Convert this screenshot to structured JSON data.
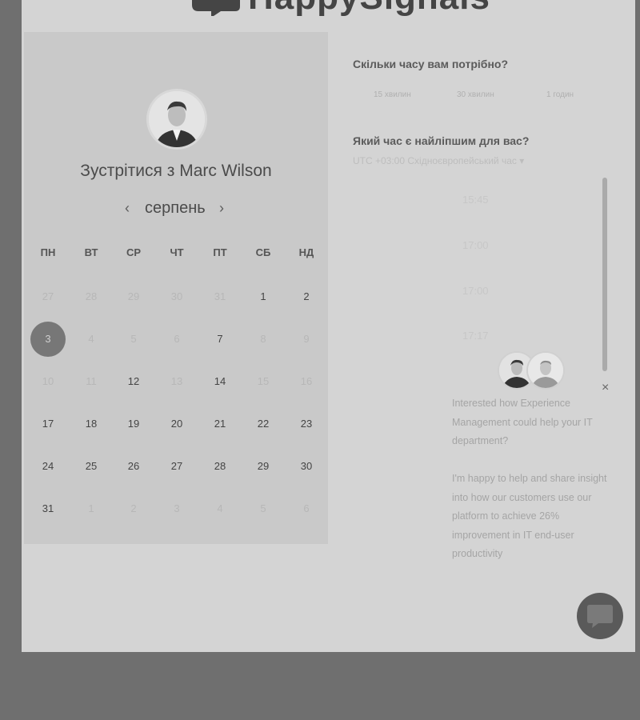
{
  "brand": {
    "name": "HappySignals"
  },
  "calendar": {
    "title": "Зустрітися з Marc Wilson",
    "month": "серпень",
    "prev_icon": "‹",
    "next_icon": "›",
    "weekdays": [
      "ПН",
      "ВТ",
      "СР",
      "ЧТ",
      "ПТ",
      "СБ",
      "НД"
    ],
    "weeks": [
      [
        {
          "d": "27",
          "s": "muted"
        },
        {
          "d": "28",
          "s": "muted"
        },
        {
          "d": "29",
          "s": "muted"
        },
        {
          "d": "30",
          "s": "muted"
        },
        {
          "d": "31",
          "s": "muted"
        },
        {
          "d": "1",
          "s": "avail"
        },
        {
          "d": "2",
          "s": "avail"
        }
      ],
      [
        {
          "d": "3",
          "s": "selected"
        },
        {
          "d": "4",
          "s": "muted"
        },
        {
          "d": "5",
          "s": "muted"
        },
        {
          "d": "6",
          "s": "muted"
        },
        {
          "d": "7",
          "s": "avail"
        },
        {
          "d": "8",
          "s": "muted"
        },
        {
          "d": "9",
          "s": "muted"
        }
      ],
      [
        {
          "d": "10",
          "s": "muted"
        },
        {
          "d": "11",
          "s": "muted"
        },
        {
          "d": "12",
          "s": "avail"
        },
        {
          "d": "13",
          "s": "muted"
        },
        {
          "d": "14",
          "s": "avail"
        },
        {
          "d": "15",
          "s": "muted"
        },
        {
          "d": "16",
          "s": "muted"
        }
      ],
      [
        {
          "d": "17",
          "s": "avail"
        },
        {
          "d": "18",
          "s": "avail"
        },
        {
          "d": "19",
          "s": "avail"
        },
        {
          "d": "20",
          "s": "avail"
        },
        {
          "d": "21",
          "s": "avail"
        },
        {
          "d": "22",
          "s": "avail"
        },
        {
          "d": "23",
          "s": "avail"
        }
      ],
      [
        {
          "d": "24",
          "s": "avail"
        },
        {
          "d": "25",
          "s": "avail"
        },
        {
          "d": "26",
          "s": "avail"
        },
        {
          "d": "27",
          "s": "avail"
        },
        {
          "d": "28",
          "s": "avail"
        },
        {
          "d": "29",
          "s": "avail"
        },
        {
          "d": "30",
          "s": "avail"
        }
      ],
      [
        {
          "d": "31",
          "s": "avail"
        },
        {
          "d": "1",
          "s": "muted"
        },
        {
          "d": "2",
          "s": "muted"
        },
        {
          "d": "3",
          "s": "muted"
        },
        {
          "d": "4",
          "s": "muted"
        },
        {
          "d": "5",
          "s": "muted"
        },
        {
          "d": "6",
          "s": "muted"
        }
      ]
    ]
  },
  "booking": {
    "duration_question": "Скільки часу вам потрібно?",
    "durations": [
      "15 хвилин",
      "30 хвилин",
      "1 годин"
    ],
    "time_question": "Який час є найліпшим для вас?",
    "timezone": "UTC +03:00 Східноєвропейський час",
    "times": [
      "15:45",
      "17:00",
      "17:00",
      "17:17"
    ]
  },
  "chat": {
    "close_icon": "×",
    "message_1": "Interested how Experience Management could help your IT department?",
    "message_2": "I'm happy to help and share insight into how our customers use our platform to achieve 26% improvement in IT end-user productivity"
  }
}
